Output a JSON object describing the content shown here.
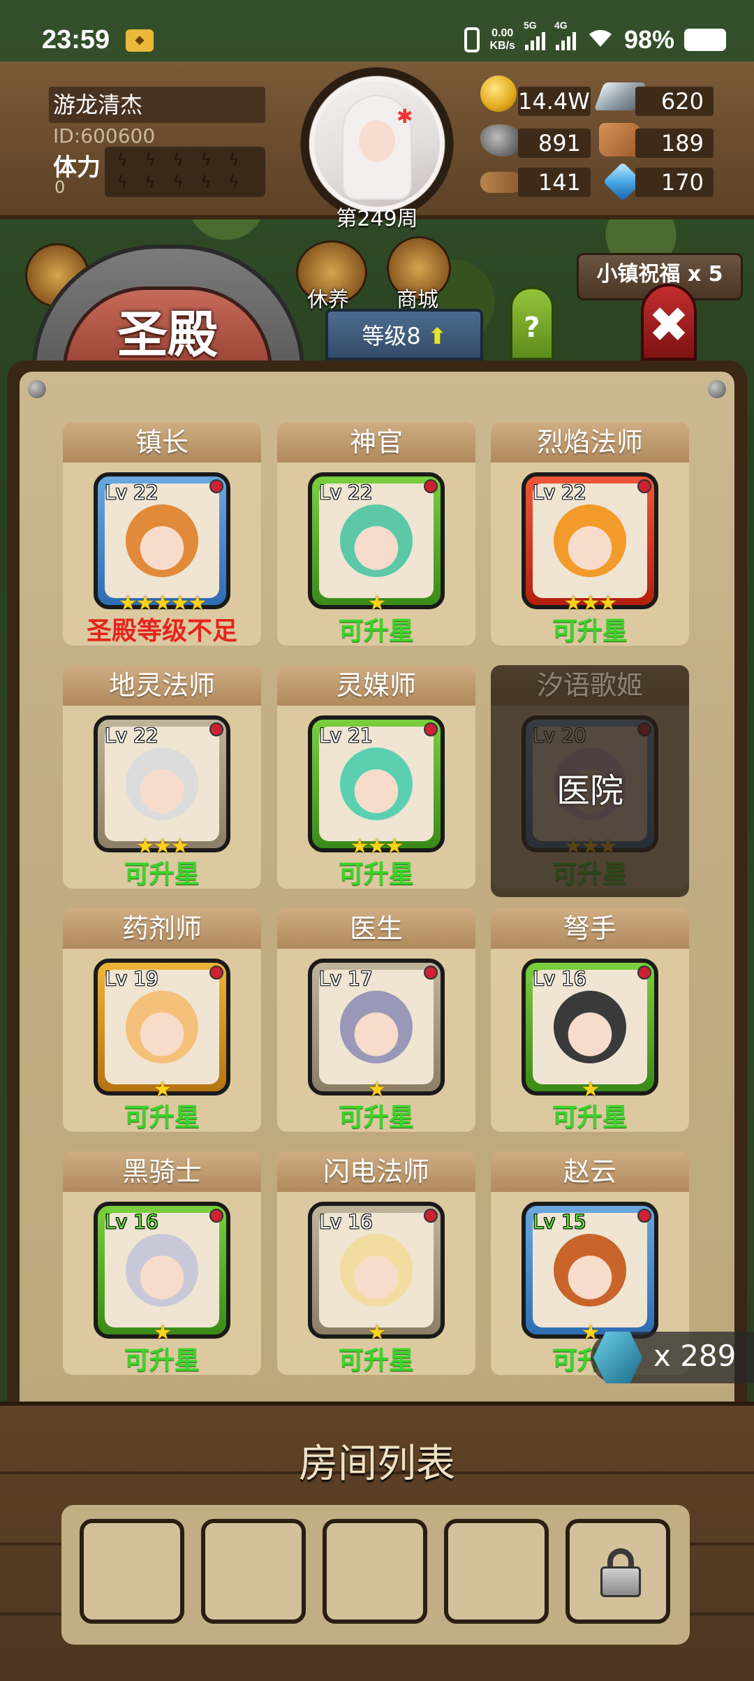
{
  "status_bar": {
    "time": "23:59",
    "netspeed_value": "0.00",
    "netspeed_unit": "KB/s",
    "sig1_label": "5G",
    "sig2_label": "4G",
    "battery": "98%"
  },
  "player": {
    "name": "游龙清杰",
    "id": "ID:600600",
    "stamina_label": "体力",
    "stamina_value": "0",
    "week": "第249周"
  },
  "resources": {
    "gold": "14.4W",
    "steel": "620",
    "stone": "891",
    "hide": "189",
    "wood": "141",
    "crystal": "170"
  },
  "nav": {
    "rest": "休养",
    "shop": "商城",
    "blessing": "小镇祝福 x 5"
  },
  "hall": {
    "title": "圣殿",
    "level": "等级8",
    "help": "?"
  },
  "heroes": [
    {
      "name": "镇长",
      "level": "Lv 22",
      "stars": "★★★★★",
      "status": "圣殿等级不足",
      "status_type": "warn",
      "frame": "blue"
    },
    {
      "name": "神官",
      "level": "Lv 22",
      "stars": "★",
      "status": "可升星",
      "status_type": "ok",
      "frame": "green"
    },
    {
      "name": "烈焰法师",
      "level": "Lv 22",
      "stars": "★★★",
      "status": "可升星",
      "status_type": "ok",
      "frame": "red"
    },
    {
      "name": "地灵法师",
      "level": "Lv 22",
      "stars": "★★★",
      "status": "可升星",
      "status_type": "ok",
      "frame": "grey"
    },
    {
      "name": "灵媒师",
      "level": "Lv 21",
      "stars": "★★★",
      "status": "可升星",
      "status_type": "ok",
      "frame": "green"
    },
    {
      "name": "汐语歌姬",
      "level": "Lv 20",
      "stars": "★★★",
      "status": "可升星",
      "status_type": "ok",
      "frame": "blue",
      "overlay": "医院"
    },
    {
      "name": "药剂师",
      "level": "Lv 19",
      "stars": "★",
      "status": "可升星",
      "status_type": "ok",
      "frame": "gold"
    },
    {
      "name": "医生",
      "level": "Lv 17",
      "stars": "★",
      "status": "可升星",
      "status_type": "ok",
      "frame": "grey"
    },
    {
      "name": "弩手",
      "level": "Lv 16",
      "stars": "★",
      "status": "可升星",
      "status_type": "ok",
      "frame": "green"
    },
    {
      "name": "黑骑士",
      "level": "Lv 16",
      "stars": "★",
      "status": "可升星",
      "status_type": "ok",
      "frame": "green"
    },
    {
      "name": "闪电法师",
      "level": "Lv 16",
      "stars": "★",
      "status": "可升星",
      "status_type": "ok",
      "frame": "grey"
    },
    {
      "name": "赵云",
      "level": "Lv 15",
      "stars": "★",
      "status": "可升星",
      "status_type": "ok",
      "frame": "blue"
    }
  ],
  "token": {
    "count": "x 289"
  },
  "rooms": {
    "title": "房间列表"
  },
  "colors": {
    "ok": "#3bd42a",
    "warn": "#e6241c",
    "parchment": "#c2ad82"
  }
}
